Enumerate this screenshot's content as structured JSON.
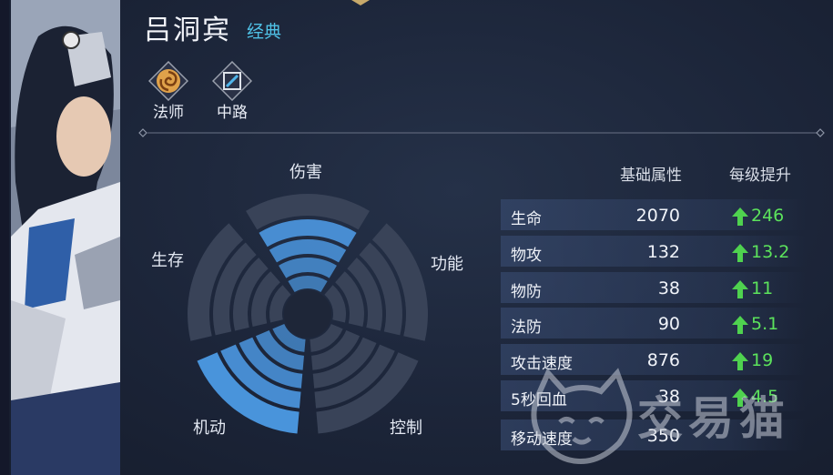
{
  "hero": {
    "name": "吕洞宾",
    "tag": "经典"
  },
  "roles": [
    {
      "label": "法师",
      "icon": "mage-swirl-icon"
    },
    {
      "label": "中路",
      "icon": "mid-lane-icon"
    }
  ],
  "radar": {
    "axes": [
      "伤害",
      "功能",
      "控制",
      "机动",
      "生存"
    ],
    "levels_filled": {
      "伤害": 4,
      "功能": 0,
      "控制": 0,
      "机动": 5,
      "生存": 0
    },
    "max_level": 5,
    "fill_color": "#4d9be6"
  },
  "stats": {
    "headers": {
      "base": "基础属性",
      "growth": "每级提升"
    },
    "rows": [
      {
        "name": "生命",
        "base": "2070",
        "growth": "246"
      },
      {
        "name": "物攻",
        "base": "132",
        "growth": "13.2"
      },
      {
        "name": "物防",
        "base": "38",
        "growth": "11"
      },
      {
        "name": "法防",
        "base": "90",
        "growth": "5.1"
      },
      {
        "name": "攻击速度",
        "base": "876",
        "growth": "19"
      },
      {
        "name": "5秒回血",
        "base": "38",
        "growth": "4.5"
      },
      {
        "name": "移动速度",
        "base": "350",
        "growth": ""
      }
    ],
    "growth_color": "#5ce35c"
  },
  "watermark": {
    "text": "交易猫"
  }
}
